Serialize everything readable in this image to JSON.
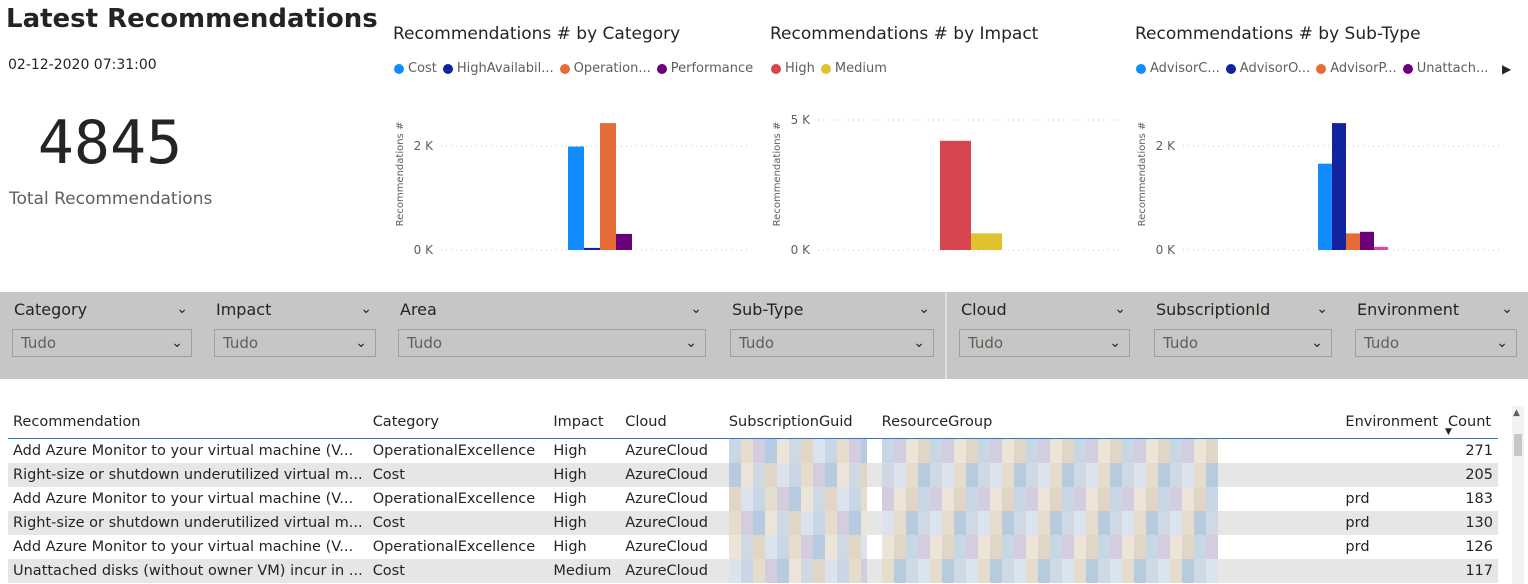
{
  "header": {
    "title": "Latest Recommendations",
    "timestamp": "02-12-2020 07:31:00"
  },
  "kpi": {
    "value": "4845",
    "label": "Total Recommendations"
  },
  "charts": {
    "category": {
      "title": "Recommendations # by Category",
      "legend": [
        {
          "label": "Cost",
          "color": "#118dff"
        },
        {
          "label": "HighAvailabil...",
          "color": "#12239e"
        },
        {
          "label": "Operation...",
          "color": "#e66c37"
        },
        {
          "label": "Performance",
          "color": "#6b007b"
        }
      ],
      "ylabel": "Recommendations #",
      "yticks": [
        "2 K",
        "0 K"
      ]
    },
    "impact": {
      "title": "Recommendations # by Impact",
      "legend": [
        {
          "label": "High",
          "color": "#d64550"
        },
        {
          "label": "Medium",
          "color": "#e0c22e"
        }
      ],
      "ylabel": "Recommendations #",
      "yticks": [
        "5 K",
        "0 K"
      ]
    },
    "subtype": {
      "title": "Recommendations # by Sub-Type",
      "legend": [
        {
          "label": "AdvisorC...",
          "color": "#118dff"
        },
        {
          "label": "AdvisorO...",
          "color": "#12239e"
        },
        {
          "label": "AdvisorP...",
          "color": "#e66c37"
        },
        {
          "label": "Unattach...",
          "color": "#6b007b"
        }
      ],
      "legend_more_icon": "play-right-icon",
      "ylabel": "Recommendations #",
      "yticks": [
        "2 K",
        "0 K"
      ]
    }
  },
  "chart_data": [
    {
      "type": "bar",
      "title": "Recommendations # by Category",
      "ylabel": "Recommendations #",
      "ylim": [
        0,
        2500
      ],
      "grid": true,
      "legend": "top",
      "series": [
        {
          "name": "Cost",
          "values": [
            1990
          ]
        },
        {
          "name": "HighAvailabil...",
          "values": [
            40
          ]
        },
        {
          "name": "Operation...",
          "values": [
            2440
          ]
        },
        {
          "name": "Performance",
          "values": [
            310
          ]
        }
      ]
    },
    {
      "type": "bar",
      "title": "Recommendations # by Impact",
      "ylabel": "Recommendations #",
      "ylim": [
        0,
        5000
      ],
      "grid": true,
      "legend": "top",
      "series": [
        {
          "name": "High",
          "values": [
            4200
          ]
        },
        {
          "name": "Medium",
          "values": [
            640
          ]
        }
      ]
    },
    {
      "type": "bar",
      "title": "Recommendations # by Sub-Type",
      "ylabel": "Recommendations #",
      "ylim": [
        0,
        2500
      ],
      "grid": true,
      "legend": "top",
      "series": [
        {
          "name": "AdvisorC...",
          "values": [
            1660
          ]
        },
        {
          "name": "AdvisorO...",
          "values": [
            2440
          ]
        },
        {
          "name": "AdvisorP...",
          "values": [
            320
          ]
        },
        {
          "name": "Unattach...",
          "values": [
            350
          ]
        },
        {
          "values": [
            60
          ]
        }
      ]
    }
  ],
  "chart_extra_color": "#e044a7",
  "slicers": [
    {
      "label": "Category",
      "value": "Tudo"
    },
    {
      "label": "Impact",
      "value": "Tudo"
    },
    {
      "label": "Area",
      "value": "Tudo"
    },
    {
      "label": "Sub-Type",
      "value": "Tudo"
    },
    {
      "label": "Cloud",
      "value": "Tudo"
    },
    {
      "label": "SubscriptionId",
      "value": "Tudo"
    },
    {
      "label": "Environment",
      "value": "Tudo"
    }
  ],
  "table": {
    "columns": [
      "Recommendation",
      "Category",
      "Impact",
      "Cloud",
      "SubscriptionGuid",
      "ResourceGroup",
      "Environment",
      "Count"
    ],
    "sort_icon": "sort-descending-icon",
    "rows": [
      {
        "recommendation": "Add Azure Monitor to your virtual machine (V...",
        "category": "OperationalExcellence",
        "impact": "High",
        "cloud": "AzureCloud",
        "environment": "",
        "count": "271"
      },
      {
        "recommendation": "Right-size or shutdown underutilized virtual m...",
        "category": "Cost",
        "impact": "High",
        "cloud": "AzureCloud",
        "environment": "",
        "count": "205"
      },
      {
        "recommendation": "Add Azure Monitor to your virtual machine (V...",
        "category": "OperationalExcellence",
        "impact": "High",
        "cloud": "AzureCloud",
        "environment": "prd",
        "count": "183"
      },
      {
        "recommendation": "Right-size or shutdown underutilized virtual m...",
        "category": "Cost",
        "impact": "High",
        "cloud": "AzureCloud",
        "environment": "prd",
        "count": "130"
      },
      {
        "recommendation": "Add Azure Monitor to your virtual machine (V...",
        "category": "OperationalExcellence",
        "impact": "High",
        "cloud": "AzureCloud",
        "environment": "prd",
        "count": "126"
      },
      {
        "recommendation": "Unattached disks (without owner VM) incur in ...",
        "category": "Cost",
        "impact": "Medium",
        "cloud": "AzureCloud",
        "environment": "",
        "count": "117"
      }
    ]
  }
}
